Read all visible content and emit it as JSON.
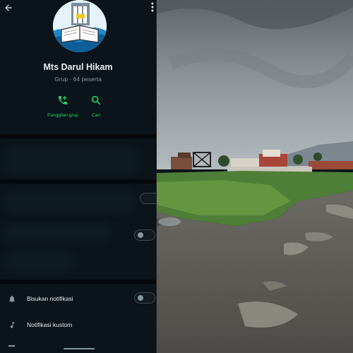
{
  "group_info": {
    "title": "Mts Darul Hikam",
    "subtitle": "Grup · 64 peserta",
    "actions": [
      {
        "label": "Panggilan grup",
        "icon": "phone-add-icon"
      },
      {
        "label": "Cari",
        "icon": "search-icon"
      }
    ],
    "settings": [
      {
        "label": "Bisukan notifikasi",
        "icon": "bell-icon",
        "toggle": false
      },
      {
        "label": "Notifikasi kustom",
        "icon": "music-note-icon"
      }
    ]
  },
  "colors": {
    "background": "#0b141a",
    "accent": "#25d366",
    "text_primary": "#e9edef",
    "text_secondary": "#8696a0"
  }
}
